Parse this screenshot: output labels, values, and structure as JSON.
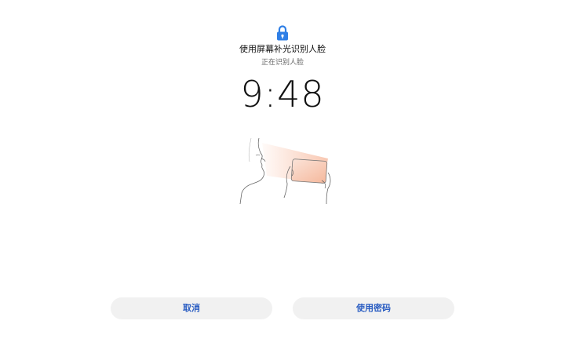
{
  "lock_screen": {
    "icon": "lock-icon",
    "title": "使用屏幕补光识别人脸",
    "status": "正在识别人脸",
    "time": "9:48",
    "illustration": "face-recognition-illustration",
    "accent_color": "#2f7fe6"
  },
  "actions": {
    "cancel_label": "取消",
    "use_password_label": "使用密码",
    "button_text_color": "#2a5dc2",
    "button_bg_color": "#f1f1f1"
  }
}
